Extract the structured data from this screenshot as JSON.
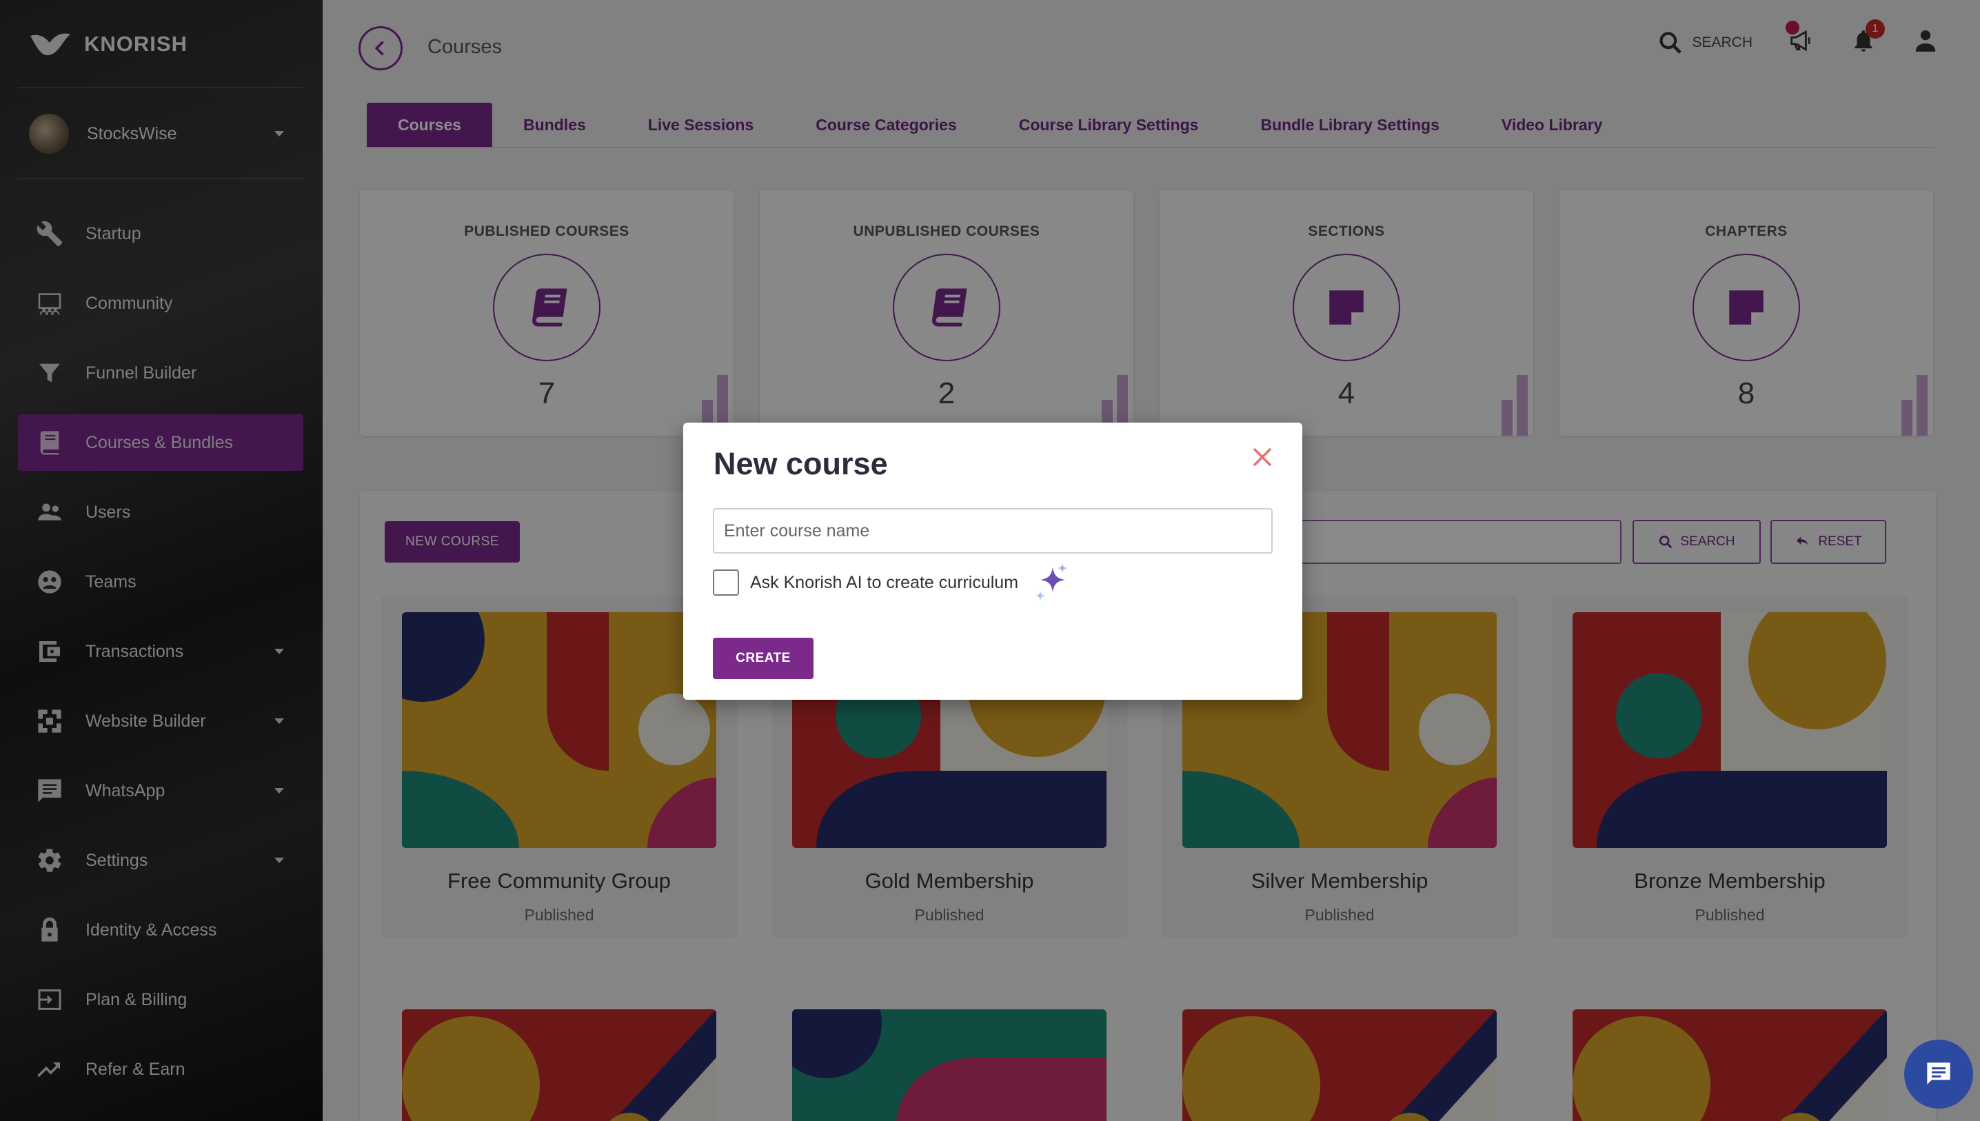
{
  "app": {
    "brand_name": "KNORISH"
  },
  "account": {
    "name": "StocksWise"
  },
  "sidebar": {
    "items": [
      {
        "label": "Startup",
        "icon": "wrench-icon",
        "active": false,
        "expandable": false
      },
      {
        "label": "Community",
        "icon": "community-icon",
        "active": false,
        "expandable": false
      },
      {
        "label": "Funnel Builder",
        "icon": "funnel-icon",
        "active": false,
        "expandable": false
      },
      {
        "label": "Courses & Bundles",
        "icon": "book-icon",
        "active": true,
        "expandable": false
      },
      {
        "label": "Users",
        "icon": "users-icon",
        "active": false,
        "expandable": false
      },
      {
        "label": "Teams",
        "icon": "teams-icon",
        "active": false,
        "expandable": false
      },
      {
        "label": "Transactions",
        "icon": "wallet-icon",
        "active": false,
        "expandable": true
      },
      {
        "label": "Website Builder",
        "icon": "website-icon",
        "active": false,
        "expandable": true
      },
      {
        "label": "WhatsApp",
        "icon": "chat-icon",
        "active": false,
        "expandable": true
      },
      {
        "label": "Settings",
        "icon": "gear-icon",
        "active": false,
        "expandable": true
      },
      {
        "label": "Identity & Access",
        "icon": "lock-icon",
        "active": false,
        "expandable": false
      },
      {
        "label": "Plan & Billing",
        "icon": "billing-icon",
        "active": false,
        "expandable": false
      },
      {
        "label": "Refer & Earn",
        "icon": "trending-icon",
        "active": false,
        "expandable": false
      }
    ]
  },
  "header": {
    "title": "Courses",
    "search_label": "SEARCH",
    "notification_count": "1"
  },
  "tabs": [
    {
      "label": "Courses",
      "active": true
    },
    {
      "label": "Bundles",
      "active": false
    },
    {
      "label": "Live Sessions",
      "active": false
    },
    {
      "label": "Course Categories",
      "active": false
    },
    {
      "label": "Course Library Settings",
      "active": false
    },
    {
      "label": "Bundle Library Settings",
      "active": false
    },
    {
      "label": "Video Library",
      "active": false
    }
  ],
  "stats": [
    {
      "label": "PUBLISHED COURSES",
      "value": "7",
      "icon": "book-icon"
    },
    {
      "label": "UNPUBLISHED COURSES",
      "value": "2",
      "icon": "book-icon"
    },
    {
      "label": "SECTIONS",
      "value": "4",
      "icon": "note-icon"
    },
    {
      "label": "CHAPTERS",
      "value": "8",
      "icon": "note-icon"
    }
  ],
  "toolbar": {
    "new_course_label": "NEW COURSE",
    "search_label": "SEARCH",
    "reset_label": "RESET"
  },
  "courses": [
    {
      "title": "Free Community Group",
      "status": "Published"
    },
    {
      "title": "Gold Membership",
      "status": "Published"
    },
    {
      "title": "Silver Membership",
      "status": "Published"
    },
    {
      "title": "Bronze Membership",
      "status": "Published"
    }
  ],
  "modal": {
    "title": "New course",
    "input_placeholder": "Enter course name",
    "input_value": "",
    "ai_checkbox_label": "Ask Knorish AI to create curriculum",
    "ai_checked": false,
    "create_label": "CREATE"
  },
  "colors": {
    "accent": "#7b2a8c",
    "notification": "#c62828",
    "chat_fab": "#2b4aa0"
  }
}
